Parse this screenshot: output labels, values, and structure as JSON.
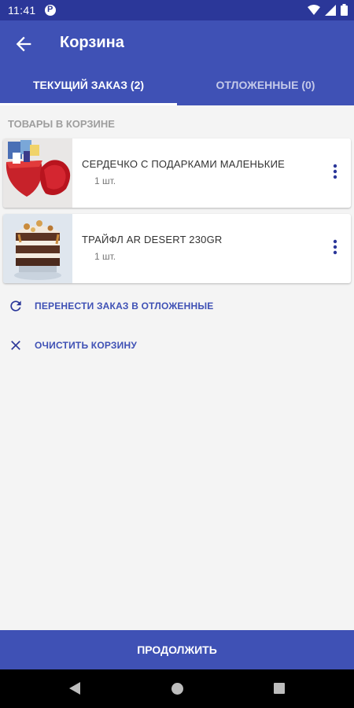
{
  "status_bar": {
    "time": "11:41"
  },
  "app_bar": {
    "title": "Корзина"
  },
  "tabs": [
    {
      "label": "ТЕКУЩИЙ ЗАКАЗ (2)",
      "active": true
    },
    {
      "label": "ОТЛОЖЕННЫЕ (0)",
      "active": false
    }
  ],
  "section": {
    "title": "ТОВАРЫ В КОРЗИНЕ"
  },
  "items": [
    {
      "name": "СЕРДЕЧКО С ПОДАРКАМИ МАЛЕНЬКИЕ",
      "qty": "1 шт."
    },
    {
      "name": "ТРАЙФЛ AR DESERT 230GR",
      "qty": "1 шт."
    }
  ],
  "actions": {
    "move_to_deferred": "ПЕРЕНЕСТИ ЗАКАЗ В ОТЛОЖЕННЫЕ",
    "clear_cart": "ОЧИСТИТЬ КОРЗИНУ"
  },
  "continue_button": {
    "label": "ПРОДОЛЖИТЬ"
  },
  "colors": {
    "primary": "#3f51b5",
    "status_bar": "#2b3799",
    "background": "#f4f4f4"
  }
}
